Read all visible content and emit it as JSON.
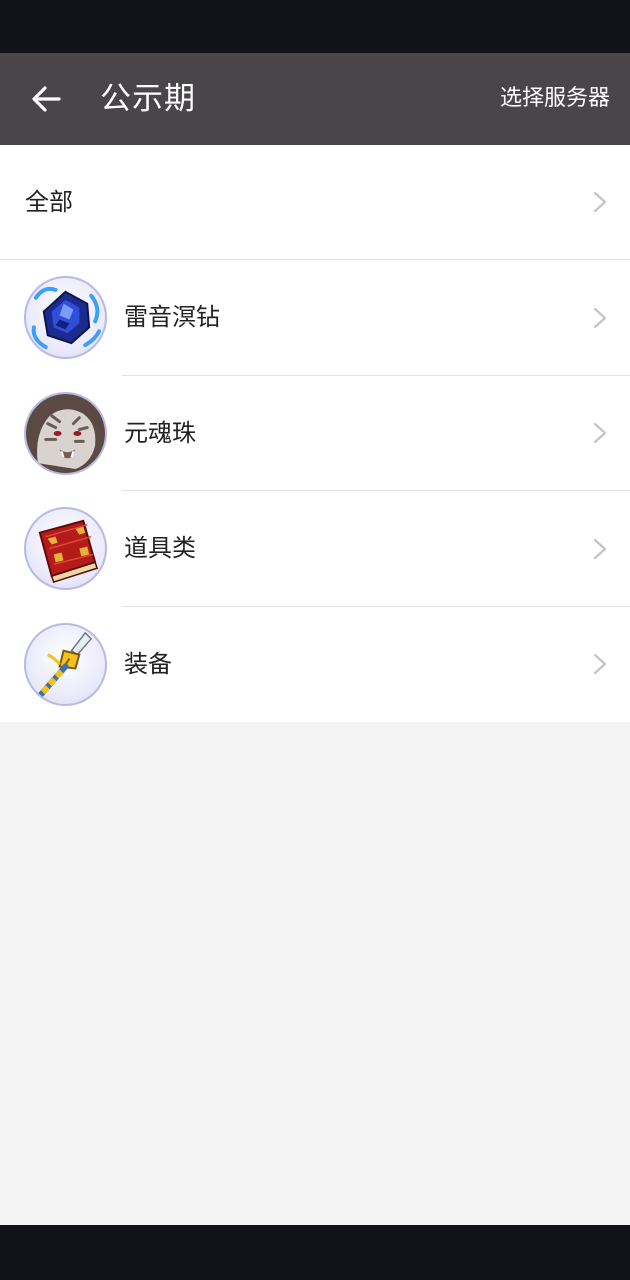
{
  "header": {
    "title": "公示期",
    "back_icon": "arrow-left-icon",
    "server_label": "选择服务器"
  },
  "list": {
    "all_label": "全部",
    "items": [
      {
        "label": "雷音溟钻",
        "icon": "blue-gem-icon"
      },
      {
        "label": "元魂珠",
        "icon": "white-tiger-icon"
      },
      {
        "label": "道具类",
        "icon": "red-book-icon"
      },
      {
        "label": "装备",
        "icon": "spear-icon"
      }
    ]
  },
  "colors": {
    "status_bar": "#121219",
    "toolbar": "#4a4549",
    "background": "#f4f4f4",
    "divider": "#e3e3e3",
    "chevron": "#c4c4c4"
  }
}
